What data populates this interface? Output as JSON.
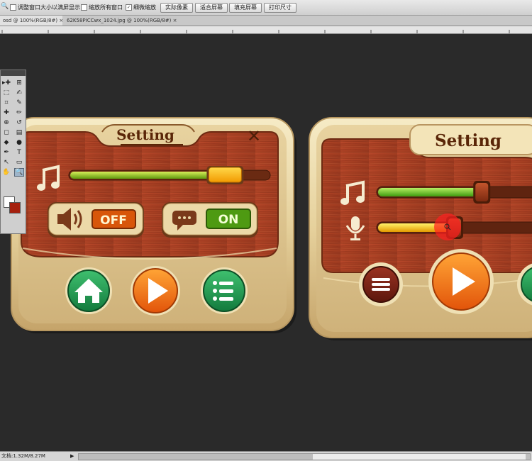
{
  "options_bar": {
    "checkboxes": [
      {
        "label": "调整窗口大小以满屏显示",
        "checked": false
      },
      {
        "label": "缩放所有窗口",
        "checked": false
      },
      {
        "label": "细微缩放",
        "checked": true
      }
    ],
    "buttons": [
      "实际像素",
      "适合屏幕",
      "填充屏幕",
      "打印尺寸"
    ]
  },
  "tabs": [
    {
      "label": "osd @ 100%(RGB/8#)",
      "close": "×"
    },
    {
      "label": "62K58PICCwx_1024.jpg @ 100%(RGB/8#)",
      "close": "×"
    }
  ],
  "toolbox": {
    "tools": [
      "move-tool",
      "artboard-tool",
      "marquee-tool",
      "lasso-tool",
      "crop-tool",
      "eyedropper-tool",
      "healing-brush-tool",
      "brush-tool",
      "clone-stamp-tool",
      "history-brush-tool",
      "eraser-tool",
      "gradient-tool",
      "blur-tool",
      "dodge-tool",
      "pen-tool",
      "type-tool",
      "path-selection-tool",
      "rectangle-tool",
      "hand-tool",
      "zoom-tool"
    ],
    "glyphs": [
      "▸✚",
      "⊞",
      "⬚",
      "✍",
      "⌗",
      "✎",
      "✚",
      "✏",
      "⊕",
      "↺",
      "◻",
      "▤",
      "◆",
      "●",
      "✒",
      "T",
      "↖",
      "▭",
      "✋",
      "🔍"
    ],
    "selected": "zoom-tool",
    "foreground_color": "#ffffff",
    "background_color": "#a5200e"
  },
  "panel1": {
    "title": "Setting",
    "close_glyph": "✕",
    "music_level": 0.78,
    "sound_button": "OFF",
    "chat_button": "ON"
  },
  "panel2": {
    "title": "Setting",
    "music_level": 0.65,
    "mic_level": 0.48
  },
  "status": {
    "doc_text": "文档:1.32M/8.27M",
    "arrow": "▶"
  }
}
